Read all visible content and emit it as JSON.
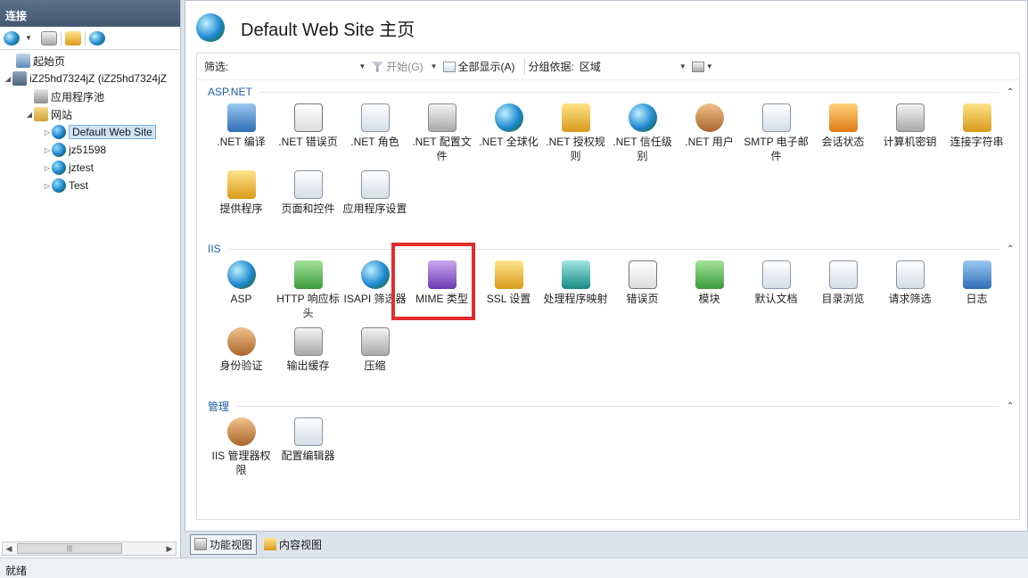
{
  "connections": {
    "header": "连接",
    "tree": [
      {
        "label": "起始页",
        "icon": "start-page-icon"
      },
      {
        "label": "iZ25hd7324jZ (iZ25hd7324jZ",
        "icon": "server-icon"
      },
      {
        "label": "应用程序池",
        "icon": "app-pool-icon"
      },
      {
        "label": "网站",
        "icon": "sites-folder-icon"
      },
      {
        "label": "Default Web Site",
        "icon": "globe-icon"
      },
      {
        "label": "jz51598",
        "icon": "globe-icon"
      },
      {
        "label": "jztest",
        "icon": "globe-icon"
      },
      {
        "label": "Test",
        "icon": "globe-icon"
      }
    ],
    "scroll_thumb": "|||"
  },
  "main": {
    "title": "Default Web Site 主页",
    "filter": {
      "label": "筛选:",
      "value": "",
      "start_label": "开始(G)",
      "show_all_label": "全部显示(A)",
      "group_label": "分组依据:",
      "group_value": "区域"
    },
    "sections": [
      {
        "name": "ASP.NET",
        "items": [
          {
            "label": ".NET 编译",
            "icon": "dotnet-compilation-icon"
          },
          {
            "label": ".NET 错误页",
            "icon": "dotnet-error-pages-icon"
          },
          {
            "label": ".NET 角色",
            "icon": "dotnet-roles-icon"
          },
          {
            "label": ".NET 配置文件",
            "icon": "dotnet-profile-icon"
          },
          {
            "label": ".NET 全球化",
            "icon": "dotnet-globalization-icon"
          },
          {
            "label": ".NET 授权规则",
            "icon": "dotnet-authorization-icon"
          },
          {
            "label": ".NET 信任级别",
            "icon": "dotnet-trust-levels-icon"
          },
          {
            "label": ".NET 用户",
            "icon": "dotnet-users-icon"
          },
          {
            "label": "SMTP 电子邮件",
            "icon": "smtp-email-icon"
          },
          {
            "label": "会话状态",
            "icon": "session-state-icon"
          },
          {
            "label": "计算机密钥",
            "icon": "machine-key-icon"
          },
          {
            "label": "连接字符串",
            "icon": "connection-strings-icon"
          },
          {
            "label": "提供程序",
            "icon": "providers-icon"
          },
          {
            "label": "页面和控件",
            "icon": "pages-controls-icon"
          },
          {
            "label": "应用程序设置",
            "icon": "app-settings-icon"
          }
        ]
      },
      {
        "name": "IIS",
        "items": [
          {
            "label": "ASP",
            "icon": "asp-icon"
          },
          {
            "label": "HTTP 响应标头",
            "icon": "http-headers-icon"
          },
          {
            "label": "ISAPI 筛选器",
            "icon": "isapi-filters-icon"
          },
          {
            "label": "MIME 类型",
            "icon": "mime-types-icon"
          },
          {
            "label": "SSL 设置",
            "icon": "ssl-settings-icon"
          },
          {
            "label": "处理程序映射",
            "icon": "handler-mappings-icon"
          },
          {
            "label": "错误页",
            "icon": "error-pages-icon"
          },
          {
            "label": "模块",
            "icon": "modules-icon"
          },
          {
            "label": "默认文档",
            "icon": "default-document-icon"
          },
          {
            "label": "目录浏览",
            "icon": "directory-browsing-icon"
          },
          {
            "label": "请求筛选",
            "icon": "request-filtering-icon"
          },
          {
            "label": "日志",
            "icon": "logging-icon"
          },
          {
            "label": "身份验证",
            "icon": "authentication-icon"
          },
          {
            "label": "输出缓存",
            "icon": "output-caching-icon"
          },
          {
            "label": "压缩",
            "icon": "compression-icon"
          }
        ]
      },
      {
        "name": "管理",
        "items": [
          {
            "label": "IIS 管理器权限",
            "icon": "iis-manager-permissions-icon"
          },
          {
            "label": "配置编辑器",
            "icon": "configuration-editor-icon"
          }
        ]
      }
    ]
  },
  "view_tabs": [
    {
      "label": "功能视图",
      "icon": "features-view-icon"
    },
    {
      "label": "内容视图",
      "icon": "content-view-icon"
    }
  ],
  "status": "就绪",
  "colors": {
    "highlight": "#e32d2d",
    "section_text": "#1c5fa6"
  }
}
